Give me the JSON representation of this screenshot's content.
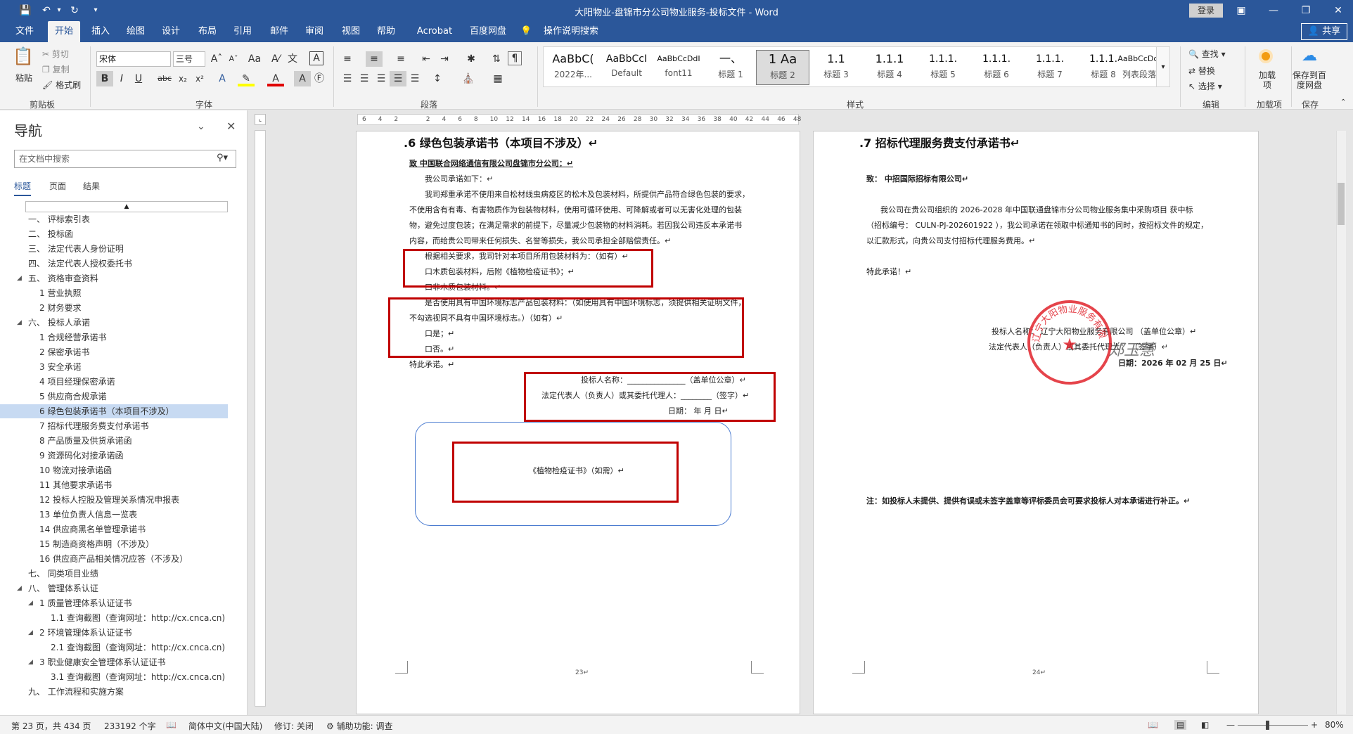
{
  "window": {
    "title": "大阳物业-盘锦市分公司物业服务-投标文件  -  Word",
    "login": "登录",
    "share": "共享"
  },
  "menu": {
    "tabs": [
      "文件",
      "开始",
      "插入",
      "绘图",
      "设计",
      "布局",
      "引用",
      "邮件",
      "审阅",
      "视图",
      "帮助",
      "Acrobat",
      "百度网盘"
    ],
    "active": "开始",
    "tell_me": "操作说明搜索"
  },
  "ribbon": {
    "clipboard": {
      "paste": "粘贴",
      "cut": "剪切",
      "copy": "复制",
      "format_painter": "格式刷",
      "group": "剪贴板"
    },
    "font": {
      "name": "宋体",
      "size": "三号",
      "group": "字体"
    },
    "paragraph": {
      "group": "段落"
    },
    "styles": {
      "group": "样式",
      "items": [
        {
          "preview": "AaBbC(",
          "name": "2022年..."
        },
        {
          "preview": "AaBbCcI",
          "name": "Default"
        },
        {
          "preview": "AaBbCcDdI",
          "name": "font11"
        },
        {
          "preview": "一、",
          "name": "标题 1"
        },
        {
          "preview": "1 Aa",
          "name": "标题 2"
        },
        {
          "preview": "1.1",
          "name": "标题 3"
        },
        {
          "preview": "1.1.1",
          "name": "标题 4"
        },
        {
          "preview": "1.1.1.",
          "name": "标题 5"
        },
        {
          "preview": "1.1.1.",
          "name": "标题 6"
        },
        {
          "preview": "1.1.1.",
          "name": "标题 7"
        },
        {
          "preview": "1.1.1.",
          "name": "标题 8"
        },
        {
          "preview": "AaBbCcDdI",
          "name": "列表段落"
        }
      ]
    },
    "editing": {
      "find": "查找",
      "replace": "替换",
      "select": "选择",
      "group": "编辑"
    },
    "addins": {
      "label": "加载项",
      "group": "加载项"
    },
    "save": {
      "label": "保存到百度网盘",
      "group": "保存"
    }
  },
  "nav": {
    "title": "导航",
    "search_placeholder": "在文档中搜索",
    "tabs": [
      "标题",
      "页面",
      "结果"
    ],
    "items": [
      {
        "level": 0,
        "text": "一、 评标索引表"
      },
      {
        "level": 0,
        "text": "二、 投标函"
      },
      {
        "level": 0,
        "text": "三、 法定代表人身份证明"
      },
      {
        "level": 0,
        "text": "四、 法定代表人授权委托书"
      },
      {
        "level": 0,
        "text": "五、 资格审查资料",
        "expand": true
      },
      {
        "level": 1,
        "text": "1 营业执照"
      },
      {
        "level": 1,
        "text": "2 财务要求"
      },
      {
        "level": 0,
        "text": "六、 投标人承诺",
        "expand": true
      },
      {
        "level": 1,
        "text": "1 合规经营承诺书"
      },
      {
        "level": 1,
        "text": "2 保密承诺书"
      },
      {
        "level": 1,
        "text": "3 安全承诺"
      },
      {
        "level": 1,
        "text": "4 项目经理保密承诺"
      },
      {
        "level": 1,
        "text": "5 供应商合规承诺"
      },
      {
        "level": 1,
        "text": "6 绿色包装承诺书（本项目不涉及）",
        "selected": true
      },
      {
        "level": 1,
        "text": "7 招标代理服务费支付承诺书"
      },
      {
        "level": 1,
        "text": "8 产品质量及供货承诺函"
      },
      {
        "level": 1,
        "text": "9 资源码化对接承诺函"
      },
      {
        "level": 1,
        "text": "10 物流对接承诺函"
      },
      {
        "level": 1,
        "text": "11 其他要求承诺书"
      },
      {
        "level": 1,
        "text": "12 投标人控股及管理关系情况申报表"
      },
      {
        "level": 1,
        "text": "13 单位负责人信息一览表"
      },
      {
        "level": 1,
        "text": "14 供应商黑名单管理承诺书"
      },
      {
        "level": 1,
        "text": "15 制造商资格声明（不涉及）"
      },
      {
        "level": 1,
        "text": "16 供应商产品相关情况应答（不涉及）"
      },
      {
        "level": 0,
        "text": "七、 同类项目业绩"
      },
      {
        "level": 0,
        "text": "八、 管理体系认证",
        "expand": true
      },
      {
        "level": 1,
        "text": "1 质量管理体系认证证书",
        "expand": true
      },
      {
        "level": 2,
        "text": "1.1 查询截图（查询网址：http://cx.cnca.cn)"
      },
      {
        "level": 1,
        "text": "2 环境管理体系认证证书",
        "expand": true
      },
      {
        "level": 2,
        "text": "2.1 查询截图（查询网址：http://cx.cnca.cn)"
      },
      {
        "level": 1,
        "text": "3 职业健康安全管理体系认证证书",
        "expand": true
      },
      {
        "level": 2,
        "text": "3.1 查询截图（查询网址：http://cx.cnca.cn)"
      },
      {
        "level": 0,
        "text": "九、 工作流程和实施方案"
      }
    ]
  },
  "ruler": {
    "ticks": [
      "6",
      "4",
      "2",
      "",
      "2",
      "4",
      "6",
      "8",
      "10",
      "12",
      "14",
      "16",
      "18",
      "20",
      "22",
      "24",
      "26",
      "28",
      "30",
      "32",
      "34",
      "36",
      "38",
      "40",
      "42",
      "44",
      "46",
      "48"
    ]
  },
  "page_left": {
    "heading": ".6  绿色包装承诺书（本项目不涉及）↵",
    "to": "致  中国联合网络通信有限公司盘锦市分公司：↵",
    "lines": [
      "我公司承诺如下：↵",
      "我司郑重承诺不使用来自松材线虫病疫区的松木及包装材料，所提供产品符合绿色包装的要求，",
      "不使用含有有毒、有害物质作为包装物材料，使用可循环使用、可降解或者可以无害化处理的包装",
      "物，避免过度包装；在满足需求的前提下，尽量减少包装物的材料消耗。若因我公司违反本承诺书",
      "内容，而给贵公司带来任何损失、名誉等损失，我公司承担全部赔偿责任。↵",
      "根据相关要求，我司针对本项目所用包装材料为：（如有）↵",
      "口木质包装材料，后附《植物检疫证书》；↵",
      "口非木质包装材料。↵",
      "是否使用具有中国环境标志产品包装材料：（如使用具有中国环境标志，须提供相关证明文件，",
      "不勾选视同不具有中国环境标志。）（如有）↵",
      "口是；↵",
      "口否。↵",
      "特此承诺。↵"
    ],
    "bidder_name": "投标人名称：_______________（盖单位公章）↵",
    "legal_rep": "法定代表人（负责人）或其委托代理人：________（签字）↵",
    "date": "日期：    年    月    日↵",
    "certificate": "《植物检疫证书》（如需）↵",
    "page_no": "23↵"
  },
  "page_right": {
    "heading": ".7  招标代理服务费支付承诺书↵",
    "to": "致：  中招国际招标有限公司↵",
    "lines": [
      "我公司在贵公司组织的  2026-2028 年中国联通盘锦市分公司物业服务集中采购项目  获中标",
      "（招标编号：  CULN-PJ-202601922  ），我公司承诺在领取中标通知书的同时，按招标文件的规定，",
      "以汇款形式，向贵公司支付招标代理服务费用。↵",
      "特此承诺！↵"
    ],
    "bidder_name": "投标人名称：  辽宁大阳物业服务有限公司   （盖单位公章）↵",
    "legal_rep": "法定代表人（负责人）或其委托代理人：           （签字）↵",
    "date": "日期：2026 年 02 月 25 日↵",
    "note": "注：如投标人未提供、提供有误或未签字盖章等评标委员会可要求投标人对本承诺进行补正。↵",
    "page_no": "24↵",
    "signature": "郑玉慧",
    "seal_text": "辽宁大阳物业服务有限公司"
  },
  "status": {
    "page": "第 23 页，共 434 页",
    "words": "233192 个字",
    "language": "简体中文(中国大陆)",
    "track": "修订: 关闭",
    "accessibility": "辅助功能: 调查",
    "zoom": "80%"
  },
  "colors": {
    "accent": "#2b579a",
    "red_box": "#c00000",
    "seal": "#e0232c"
  }
}
